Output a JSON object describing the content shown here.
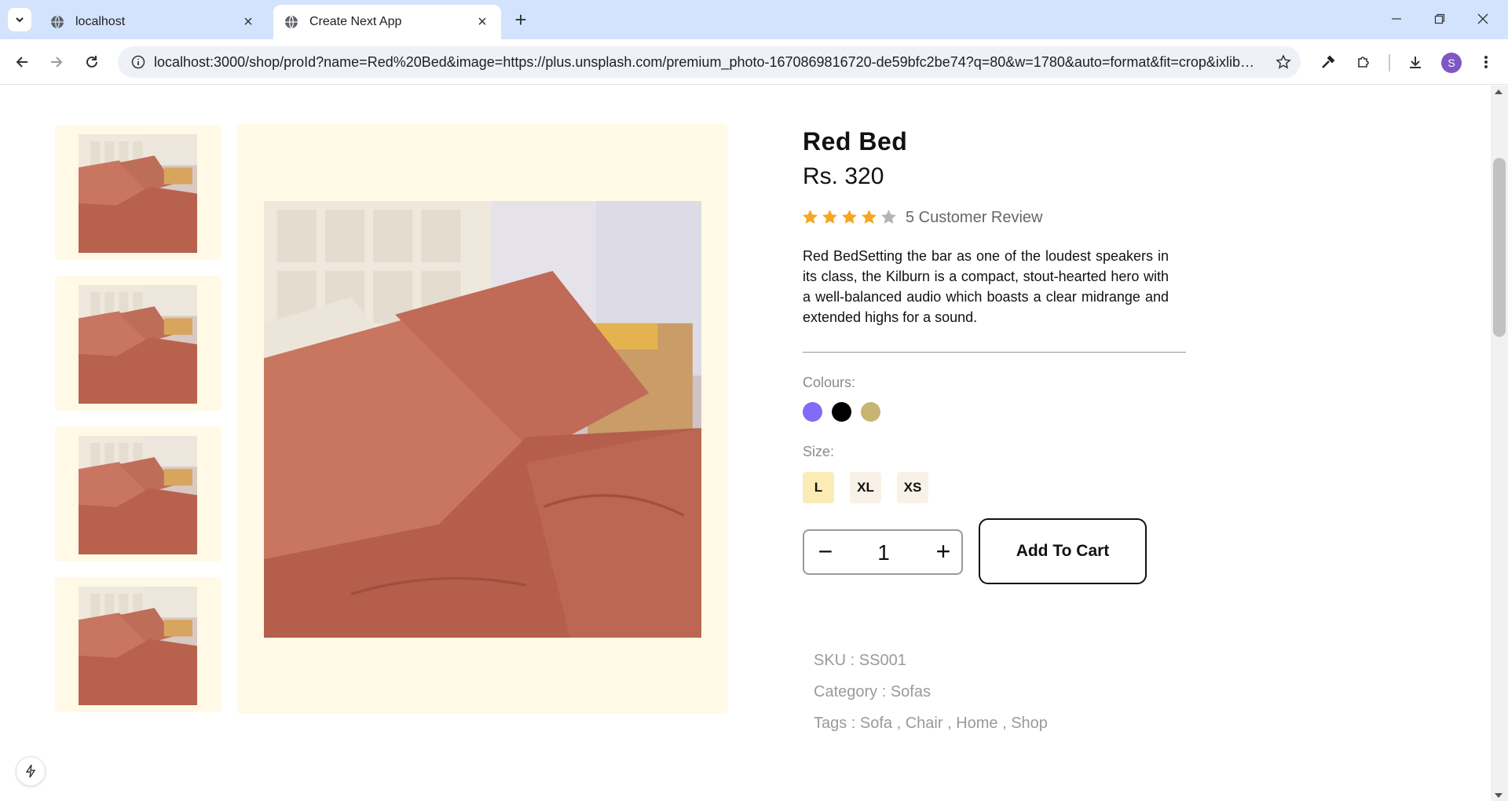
{
  "browser": {
    "tabs": [
      {
        "title": "localhost",
        "active": false
      },
      {
        "title": "Create Next App",
        "active": true
      }
    ],
    "url": "localhost:3000/shop/proId?name=Red%20Bed&image=https://plus.unsplash.com/premium_photo-1670869816720-de59bfc2be74?q=80&w=1780&auto=format&fit=crop&ixlib=r...",
    "profile_initial": "S"
  },
  "product": {
    "name": "Red Bed",
    "price": "Rs. 320",
    "rating": 4,
    "rating_max": 5,
    "review_text": "5 Customer Review",
    "description": "Red BedSetting the bar as one of the loudest speakers in its class, the Kilburn is a compact, stout-hearted hero with a well-balanced audio which boasts a clear midrange and extended highs for a sound.",
    "colours_label": "Colours:",
    "colours": [
      "#816bf7",
      "#000000",
      "#c8b572"
    ],
    "size_label": "Size:",
    "sizes": [
      {
        "label": "L",
        "selected": true
      },
      {
        "label": "XL",
        "selected": false
      },
      {
        "label": "XS",
        "selected": false
      }
    ],
    "quantity": "1",
    "add_to_cart": "Add To Cart",
    "sku": "SKU : SS001",
    "category": "Category : Sofas",
    "tags": "Tags : Sofa , Chair , Home , Shop"
  },
  "colors": {
    "card_bg": "#fff9e6",
    "star_active": "#f5a623",
    "star_inactive": "#b5b5b5",
    "size_selected_bg": "#fbebb5",
    "size_default_bg": "#f9f1e7"
  }
}
